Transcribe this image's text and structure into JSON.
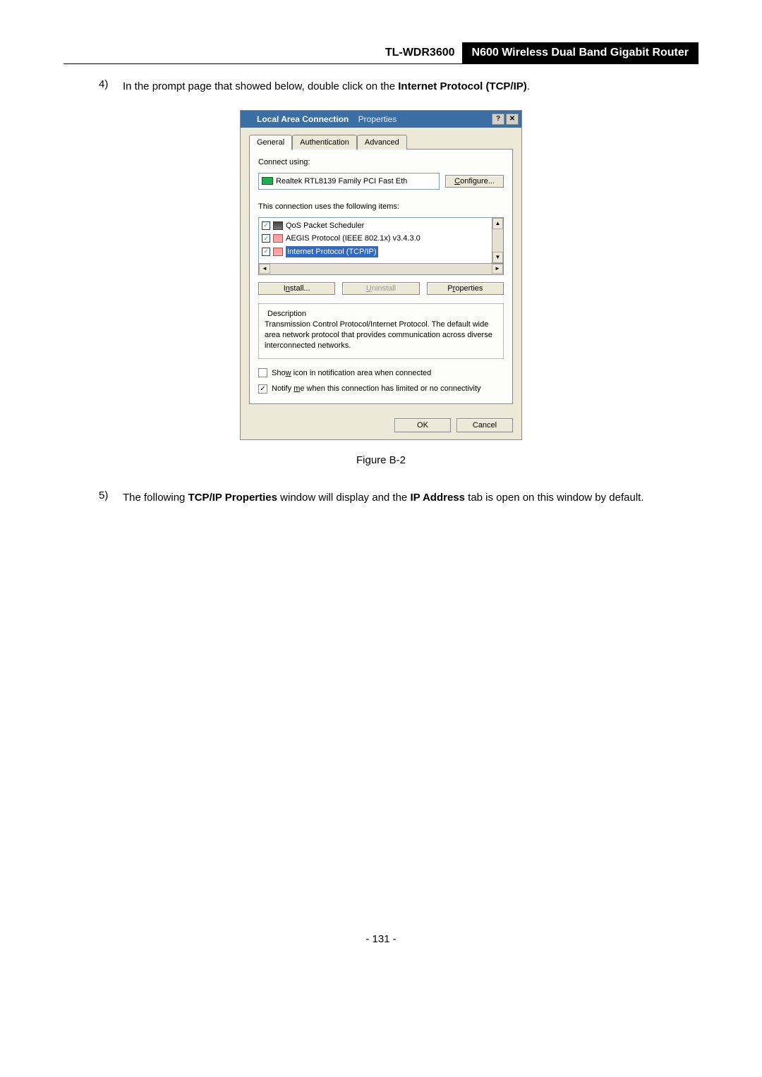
{
  "header": {
    "model": "TL-WDR3600",
    "description": "N600 Wireless Dual Band Gigabit Router"
  },
  "steps": {
    "s4": {
      "num": "4)",
      "pre": "In the prompt page that showed below, double click on the ",
      "bold": "Internet Protocol (TCP/IP)",
      "post": "."
    },
    "s5": {
      "num": "5)",
      "pre": "The following ",
      "b1": "TCP/IP Properties",
      "mid": " window will display and the ",
      "b2": "IP Address",
      "post": " tab is open on this window by default."
    }
  },
  "fig_caption": "Figure B-2",
  "page_number": "- 131 -",
  "dialog": {
    "title_main": "Local Area Connection",
    "title_props": "Properties",
    "tabs": {
      "general": "General",
      "auth": "Authentication",
      "adv": "Advanced"
    },
    "connect_using_label": "Connect using:",
    "adapter_name": "Realtek RTL8139 Family PCI Fast Eth",
    "configure_btn": "Configure...",
    "items_label": "This connection uses the following items:",
    "items": {
      "qos": "QoS Packet Scheduler",
      "aegis": "AEGIS Protocol (IEEE 802.1x) v3.4.3.0",
      "tcpip": "Internet Protocol (TCP/IP)"
    },
    "install_btn": "Install...",
    "uninstall_btn": "Uninstall",
    "properties_btn": "Properties",
    "desc_label": "Description",
    "desc_text": "Transmission Control Protocol/Internet Protocol. The default wide area network protocol that provides communication across diverse interconnected networks.",
    "show_icon": "Show icon in notification area when connected",
    "notify": "Notify me when this connection has limited or no connectivity",
    "ok": "OK",
    "cancel": "Cancel"
  }
}
